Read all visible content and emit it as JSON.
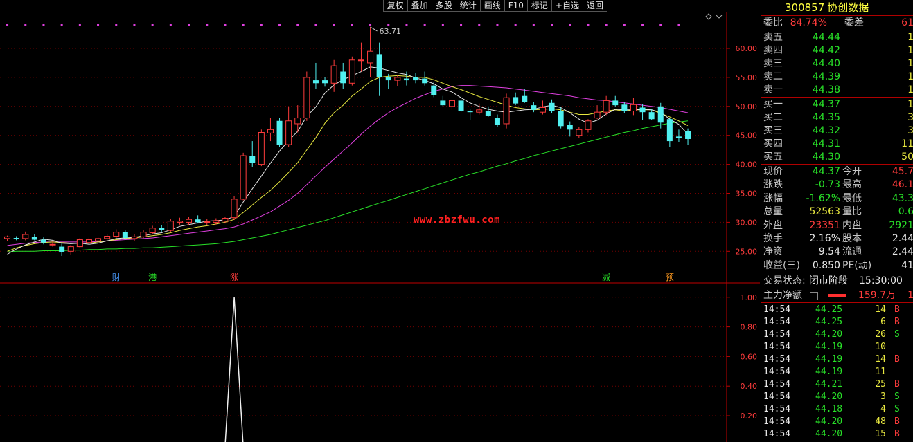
{
  "toolbar": [
    {
      "label": "复权"
    },
    {
      "label": "叠加"
    },
    {
      "label": "多股"
    },
    {
      "label": "统计"
    },
    {
      "label": "画线"
    },
    {
      "label": "F10"
    },
    {
      "label": "标记"
    },
    {
      "label": "+自选"
    },
    {
      "label": "返回"
    }
  ],
  "watermark": "www.zbzfwu.com",
  "colors": {
    "up": "#ff3c3c",
    "down": "#50f0f0",
    "ma5": "#e8e8e8",
    "ma10": "#e8e840",
    "ma20": "#e040e0",
    "ma60": "#28e028",
    "grid": "#700000",
    "axis": "#c00000"
  },
  "chart_data": [
    {
      "type": "candlestick",
      "title": "",
      "high_label": "63.71",
      "y_ticks": [
        "60.00",
        "55.00",
        "50.00",
        "45.00",
        "40.00",
        "35.00",
        "30.00",
        "25.00"
      ],
      "ylim": [
        22.5,
        66
      ],
      "ohlc": [
        [
          27.2,
          27.7,
          26.8,
          27.5
        ],
        [
          27.3,
          27.6,
          26.9,
          27.2
        ],
        [
          27.2,
          28.4,
          26.9,
          27.9
        ],
        [
          27.5,
          28.0,
          26.9,
          27.0
        ],
        [
          27.0,
          27.4,
          26.2,
          26.5
        ],
        [
          26.2,
          26.8,
          25.8,
          26.2
        ],
        [
          25.8,
          26.5,
          24.2,
          24.8
        ],
        [
          25.0,
          26.1,
          24.4,
          25.8
        ],
        [
          25.8,
          27.3,
          25.6,
          27.0
        ],
        [
          26.5,
          27.4,
          26.2,
          27.0
        ],
        [
          26.8,
          27.5,
          26.5,
          27.2
        ],
        [
          27.2,
          28.0,
          27.0,
          27.6
        ],
        [
          27.6,
          28.8,
          27.3,
          28.3
        ],
        [
          28.3,
          28.6,
          27.0,
          27.3
        ],
        [
          27.2,
          27.9,
          26.8,
          27.5
        ],
        [
          27.5,
          28.6,
          27.3,
          28.3
        ],
        [
          28.2,
          29.4,
          28.0,
          29.0
        ],
        [
          29.0,
          29.5,
          28.4,
          28.7
        ],
        [
          28.6,
          30.6,
          28.4,
          30.2
        ],
        [
          30.0,
          30.8,
          29.6,
          30.2
        ],
        [
          30.0,
          31.0,
          29.5,
          30.5
        ],
        [
          30.5,
          31.2,
          29.8,
          30.0
        ],
        [
          30.0,
          30.6,
          29.5,
          30.1
        ],
        [
          30.0,
          30.7,
          29.6,
          30.3
        ],
        [
          30.2,
          31.0,
          29.8,
          30.7
        ],
        [
          30.8,
          34.5,
          30.4,
          34.0
        ],
        [
          34.0,
          42.0,
          33.8,
          41.5
        ],
        [
          41.4,
          44.0,
          39.6,
          40.2
        ],
        [
          40.0,
          46.0,
          39.7,
          45.5
        ],
        [
          45.4,
          48.0,
          44.0,
          46.0
        ],
        [
          47.5,
          48.0,
          43.0,
          43.4
        ],
        [
          43.4,
          50.0,
          43.0,
          47.5
        ],
        [
          47.0,
          50.2,
          45.5,
          48.0
        ],
        [
          48.0,
          56.0,
          47.5,
          55.0
        ],
        [
          54.5,
          57.5,
          53.0,
          54.0
        ],
        [
          54.5,
          55.0,
          53.4,
          54.0
        ],
        [
          54.0,
          58.0,
          52.5,
          57.0
        ],
        [
          56.0,
          57.5,
          53.0,
          54.0
        ],
        [
          54.0,
          58.6,
          53.6,
          58.0
        ],
        [
          58.0,
          61.0,
          56.0,
          58.0
        ],
        [
          57.5,
          63.71,
          55.0,
          59.5
        ],
        [
          59.0,
          61.0,
          51.8,
          55.0
        ],
        [
          55.0,
          55.6,
          53.0,
          54.5
        ],
        [
          54.5,
          55.4,
          53.5,
          55.0
        ],
        [
          54.8,
          56.0,
          53.6,
          54.5
        ],
        [
          55.0,
          55.8,
          54.0,
          54.5
        ],
        [
          54.8,
          56.0,
          53.6,
          54.0
        ],
        [
          53.6,
          54.2,
          51.6,
          52.0
        ],
        [
          51.0,
          51.8,
          50.0,
          50.2
        ],
        [
          50.0,
          51.2,
          49.4,
          51.0
        ],
        [
          51.0,
          51.8,
          49.0,
          49.2
        ],
        [
          49.2,
          49.6,
          47.6,
          49.0
        ],
        [
          49.0,
          50.5,
          48.6,
          49.4
        ],
        [
          49.2,
          50.0,
          48.2,
          48.4
        ],
        [
          48.0,
          48.6,
          46.5,
          46.8
        ],
        [
          47.0,
          52.2,
          46.2,
          51.5
        ],
        [
          51.6,
          52.4,
          50.2,
          50.5
        ],
        [
          51.8,
          53.0,
          50.6,
          50.8
        ],
        [
          50.2,
          50.8,
          49.0,
          49.4
        ],
        [
          49.0,
          51.0,
          48.6,
          49.8
        ],
        [
          50.6,
          51.2,
          48.8,
          49.2
        ],
        [
          49.2,
          49.8,
          46.2,
          46.6
        ],
        [
          46.8,
          47.4,
          44.8,
          46.0
        ],
        [
          45.0,
          46.4,
          44.6,
          46.0
        ],
        [
          46.0,
          47.8,
          45.5,
          47.5
        ],
        [
          48.0,
          50.2,
          47.8,
          49.0
        ],
        [
          49.0,
          51.8,
          48.5,
          51.0
        ],
        [
          51.0,
          51.8,
          50.0,
          50.2
        ],
        [
          50.3,
          50.8,
          48.8,
          49.2
        ],
        [
          49.2,
          51.5,
          48.5,
          50.3
        ],
        [
          49.8,
          50.4,
          47.6,
          49.0
        ],
        [
          49.0,
          49.6,
          47.6,
          47.8
        ],
        [
          50.0,
          50.6,
          46.2,
          47.2
        ],
        [
          47.8,
          48.0,
          43.0,
          44.0
        ],
        [
          44.8,
          46.0,
          43.8,
          44.5
        ],
        [
          45.7,
          46.2,
          43.4,
          44.37
        ]
      ],
      "ma_values": {
        "ma5": [
          24.5,
          25.4,
          26.1,
          26.6,
          27.1,
          26.9,
          26.4,
          26.3,
          26.4,
          26.2,
          26.4,
          26.8,
          27.2,
          27.3,
          27.4,
          27.7,
          28.0,
          28.2,
          28.7,
          29.3,
          29.6,
          29.9,
          30.2,
          30.3,
          30.4,
          31.0,
          33.5,
          35.8,
          38.0,
          40.2,
          42.3,
          44.1,
          45.7,
          48.3,
          49.9,
          52.3,
          53.7,
          54.6,
          55.3,
          56.0,
          56.8,
          56.6,
          56.2,
          55.8,
          55.5,
          54.9,
          54.5,
          53.9,
          53.0,
          52.5,
          51.5,
          50.6,
          50.0,
          49.5,
          49.2,
          49.0,
          49.2,
          49.4,
          49.5,
          49.9,
          50.2,
          49.8,
          48.9,
          47.8,
          47.1,
          47.6,
          48.7,
          49.5,
          49.4,
          49.4,
          49.5,
          49.4,
          49.0,
          47.8,
          46.9,
          45.2
        ],
        "ma10": [
          25.0,
          25.6,
          26.0,
          26.3,
          26.5,
          26.6,
          26.5,
          26.4,
          26.4,
          26.4,
          26.6,
          26.8,
          27.0,
          27.2,
          27.3,
          27.5,
          27.7,
          27.9,
          28.2,
          28.6,
          28.9,
          29.2,
          29.4,
          29.7,
          30.0,
          30.5,
          31.7,
          33.0,
          34.3,
          35.5,
          37.0,
          38.6,
          40.3,
          42.5,
          44.6,
          47.1,
          48.9,
          50.2,
          51.8,
          53.0,
          54.3,
          55.0,
          55.2,
          55.3,
          55.2,
          55.0,
          55.0,
          54.6,
          54.0,
          53.4,
          52.9,
          52.3,
          51.7,
          51.2,
          50.7,
          50.2,
          49.8,
          49.6,
          49.4,
          49.5,
          49.6,
          49.4,
          49.0,
          48.6,
          48.6,
          48.9,
          49.2,
          49.4,
          49.2,
          49.4,
          49.4,
          49.4,
          48.8,
          48.2,
          47.5,
          46.7
        ],
        "ma20": [
          26.0,
          26.2,
          26.4,
          26.5,
          26.6,
          26.6,
          26.6,
          26.6,
          26.6,
          26.6,
          26.7,
          26.8,
          26.9,
          27.0,
          27.1,
          27.2,
          27.3,
          27.5,
          27.7,
          27.9,
          28.1,
          28.3,
          28.5,
          28.7,
          28.9,
          29.2,
          29.7,
          30.4,
          31.1,
          31.8,
          32.8,
          33.8,
          35.0,
          36.5,
          38.0,
          39.5,
          40.9,
          42.3,
          43.7,
          45.2,
          46.6,
          47.8,
          48.9,
          49.8,
          50.6,
          51.4,
          52.0,
          52.6,
          53.0,
          53.4,
          53.6,
          53.6,
          53.5,
          53.4,
          53.3,
          53.2,
          53.0,
          52.8,
          52.6,
          52.4,
          52.2,
          52.0,
          51.8,
          51.5,
          51.3,
          51.1,
          51.0,
          50.8,
          50.6,
          50.4,
          50.2,
          50.0,
          49.8,
          49.5,
          49.2,
          48.9
        ],
        "ma60": [
          24.9,
          25.0,
          25.0,
          25.0,
          25.1,
          25.1,
          25.1,
          25.2,
          25.2,
          25.3,
          25.3,
          25.4,
          25.4,
          25.5,
          25.5,
          25.6,
          25.6,
          25.7,
          25.8,
          25.9,
          26.0,
          26.1,
          26.2,
          26.3,
          26.5,
          26.7,
          27.0,
          27.3,
          27.6,
          27.9,
          28.3,
          28.7,
          29.1,
          29.5,
          29.9,
          30.3,
          30.8,
          31.3,
          31.8,
          32.3,
          32.8,
          33.3,
          33.8,
          34.3,
          34.8,
          35.3,
          35.8,
          36.3,
          36.8,
          37.3,
          37.8,
          38.3,
          38.7,
          39.2,
          39.7,
          40.1,
          40.6,
          41.0,
          41.5,
          41.9,
          42.3,
          42.7,
          43.1,
          43.5,
          43.9,
          44.3,
          44.7,
          45.1,
          45.5,
          45.8,
          46.2,
          46.5,
          46.8,
          47.1,
          47.3,
          47.5
        ]
      }
    },
    {
      "type": "line",
      "title": "",
      "y_ticks": [
        "1.00",
        "0.80",
        "0.60",
        "0.40",
        "0.20"
      ],
      "ylim": [
        0,
        1.1
      ],
      "values": [
        0,
        0,
        0,
        0,
        0,
        0,
        0,
        0,
        0,
        0,
        0,
        0,
        0,
        0,
        0,
        0,
        0,
        0,
        0,
        0,
        0,
        0,
        0,
        0,
        0,
        1,
        0,
        0,
        0,
        0,
        0,
        0,
        0,
        0,
        0,
        0,
        0,
        0,
        0,
        0,
        0,
        0,
        0,
        0,
        0,
        0,
        0,
        0,
        0,
        0,
        0,
        0,
        0,
        0,
        0,
        0,
        0,
        0,
        0,
        0,
        0,
        0,
        0,
        0,
        0,
        0,
        0,
        0,
        0,
        0,
        0,
        0,
        0,
        0,
        0,
        0
      ]
    }
  ],
  "event_markers": [
    {
      "label": "财",
      "index": 12,
      "color": "#4a9bff"
    },
    {
      "label": "港",
      "index": 16,
      "color": "#28e028"
    },
    {
      "label": "涨",
      "index": 25,
      "color": "#ff3c3c"
    },
    {
      "label": "减",
      "index": 66,
      "color": "#28e028"
    },
    {
      "label": "预",
      "index": 73,
      "color": "#ff9a20"
    }
  ],
  "panel": {
    "code": "300857",
    "name": "协创数据",
    "weibi_label": "委比",
    "weibi_value": "84.74%",
    "weicha_label": "委差",
    "weicha_value": "61",
    "asks": [
      {
        "label": "卖五",
        "price": "44.44",
        "vol": "1"
      },
      {
        "label": "卖四",
        "price": "44.42",
        "vol": "1"
      },
      {
        "label": "卖三",
        "price": "44.40",
        "vol": "1"
      },
      {
        "label": "卖二",
        "price": "44.39",
        "vol": "1"
      },
      {
        "label": "卖一",
        "price": "44.38",
        "vol": "1"
      }
    ],
    "bids": [
      {
        "label": "买一",
        "price": "44.37",
        "vol": "1"
      },
      {
        "label": "买二",
        "price": "44.35",
        "vol": "3"
      },
      {
        "label": "买三",
        "price": "44.32",
        "vol": "3"
      },
      {
        "label": "买四",
        "price": "44.31",
        "vol": "11"
      },
      {
        "label": "买五",
        "price": "44.30",
        "vol": "50"
      }
    ],
    "quote": [
      {
        "l1": "现价",
        "v1": "44.37",
        "c1": "green",
        "l2": "今开",
        "v2": "45.7",
        "c2": "red"
      },
      {
        "l1": "涨跌",
        "v1": "-0.73",
        "c1": "green",
        "l2": "最高",
        "v2": "46.1",
        "c2": "red"
      },
      {
        "l1": "涨幅",
        "v1": "-1.62%",
        "c1": "green",
        "l2": "最低",
        "v2": "43.3",
        "c2": "green"
      },
      {
        "l1": "总量",
        "v1": "52563",
        "c1": "yellow",
        "l2": "量比",
        "v2": "0.6",
        "c2": "green"
      },
      {
        "l1": "外盘",
        "v1": "23351",
        "c1": "red",
        "l2": "内盘",
        "v2": "2921",
        "c2": "green"
      },
      {
        "l1": "换手",
        "v1": "2.16%",
        "c1": "white",
        "l2": "股本",
        "v2": "2.44",
        "c2": "white"
      },
      {
        "l1": "净资",
        "v1": "9.54",
        "c1": "white",
        "l2": "流通",
        "v2": "2.44",
        "c2": "white"
      },
      {
        "l1": "收益(三)",
        "v1": "0.850",
        "c1": "white",
        "l2": "PE(动)",
        "v2": "41",
        "c2": "white"
      }
    ],
    "status_label": "交易状态:",
    "status_value": "闭市阶段",
    "status_time": "15:30:00",
    "mainflow_label": "主力净额",
    "mainflow_value": "159.7万",
    "mainflow_extra": "1",
    "trades": [
      {
        "time": "14:54",
        "price": "44.25",
        "vol": "14",
        "side": "B"
      },
      {
        "time": "14:54",
        "price": "44.25",
        "vol": "6",
        "side": "B"
      },
      {
        "time": "14:54",
        "price": "44.20",
        "vol": "26",
        "side": "S"
      },
      {
        "time": "14:54",
        "price": "44.19",
        "vol": "10",
        "side": ""
      },
      {
        "time": "14:54",
        "price": "44.19",
        "vol": "14",
        "side": "B"
      },
      {
        "time": "14:54",
        "price": "44.19",
        "vol": "11",
        "side": ""
      },
      {
        "time": "14:54",
        "price": "44.21",
        "vol": "25",
        "side": "B"
      },
      {
        "time": "14:54",
        "price": "44.20",
        "vol": "3",
        "side": "S"
      },
      {
        "time": "14:54",
        "price": "44.18",
        "vol": "4",
        "side": "S"
      },
      {
        "time": "14:54",
        "price": "44.20",
        "vol": "48",
        "side": "B"
      },
      {
        "time": "14:54",
        "price": "44.20",
        "vol": "15",
        "side": "B"
      }
    ]
  }
}
